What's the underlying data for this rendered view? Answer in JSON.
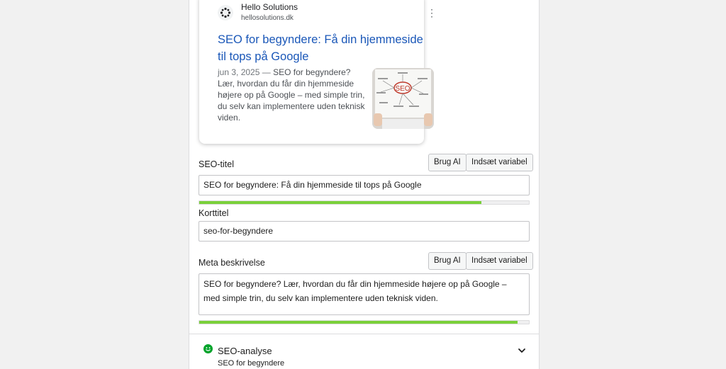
{
  "serp": {
    "site_name": "Hello Solutions",
    "site_url": "hellosolutions.dk",
    "title": "SEO for begyndere: Få din hjemmeside til tops på Google",
    "date": "jun 3, 2025",
    "separator": "—",
    "description": "SEO for begyndere? Lær, hvordan du får din hjemmeside højere op på Google – med simple trin, du selv kan implementere uden teknisk viden.",
    "thumb_text": "SEO"
  },
  "seo_title": {
    "label": "SEO-titel",
    "ai_button": "Brug AI",
    "variable_button": "Indsæt variabel",
    "value": "SEO for begyndere: Få din hjemmeside til tops på Google",
    "progress": 0.855
  },
  "slug": {
    "label": "Korttitel",
    "value": "seo-for-begyndere"
  },
  "meta_description": {
    "label": "Meta beskrivelse",
    "ai_button": "Brug AI",
    "variable_button": "Indsæt variabel",
    "value": "SEO for begyndere? Lær, hvordan du får din hjemmeside højere op på Google – med simple trin, du selv kan implementere uden teknisk viden.",
    "progress": 0.965
  },
  "analysis": {
    "title": "SEO-analyse",
    "subtitle": "SEO for begyndere",
    "status_color": "#00a32a"
  }
}
